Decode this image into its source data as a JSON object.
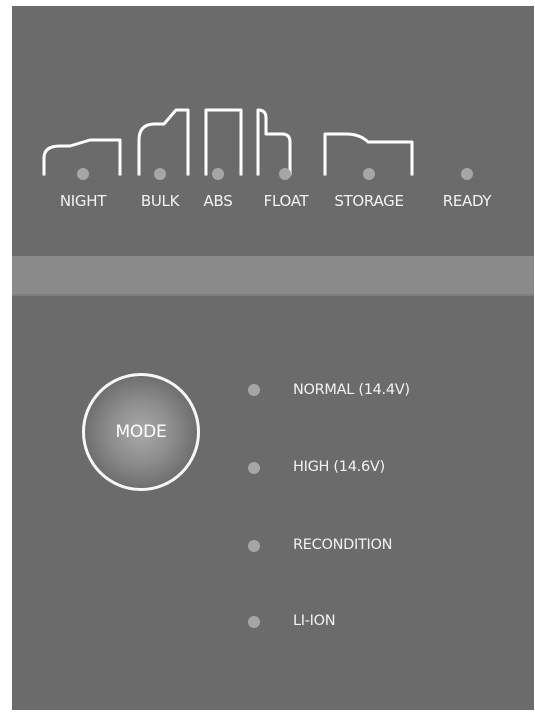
{
  "stages": [
    {
      "id": "night",
      "label": "NIGHT"
    },
    {
      "id": "bulk",
      "label": "BULK"
    },
    {
      "id": "abs",
      "label": "ABS"
    },
    {
      "id": "float",
      "label": "FLOAT"
    },
    {
      "id": "storage",
      "label": "STORAGE"
    },
    {
      "id": "ready",
      "label": "READY"
    }
  ],
  "mode_button": {
    "label": "MODE"
  },
  "modes": [
    {
      "id": "normal",
      "label": "NORMAL (14.4V)"
    },
    {
      "id": "high",
      "label": "HIGH (14.6V)"
    },
    {
      "id": "recondition",
      "label": "RECONDITION"
    },
    {
      "id": "li-ion",
      "label": "LI-ION"
    }
  ],
  "colors": {
    "panel": "#6b6b6b",
    "band": "#8a8a8a",
    "led_off": "#a6a6a6",
    "text": "#f2f2f2"
  }
}
